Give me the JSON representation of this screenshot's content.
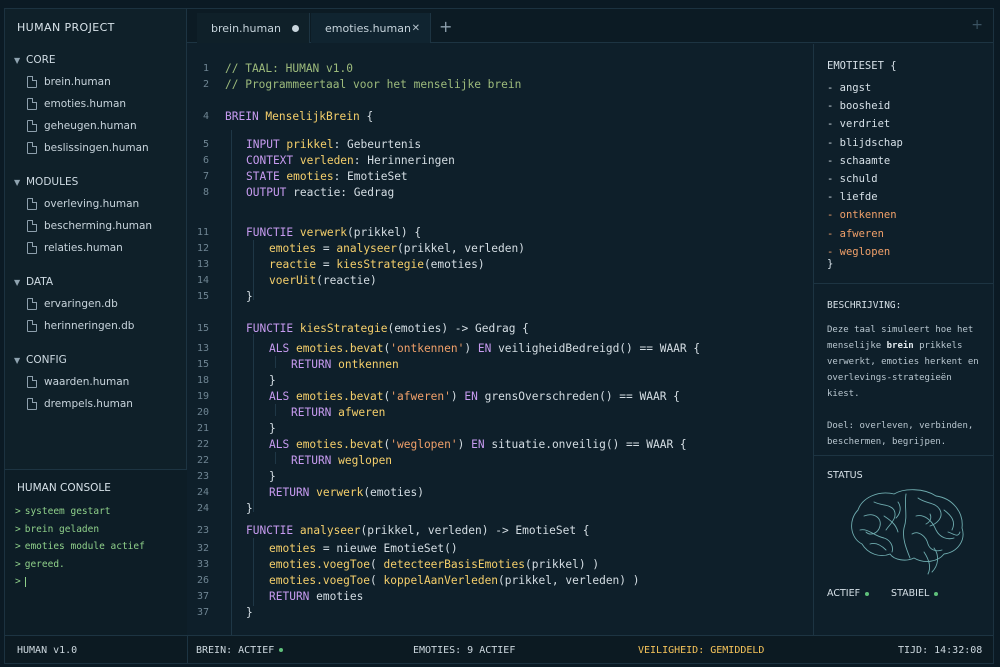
{
  "sidebar": {
    "title": "HUMAN PROJECT",
    "groups": [
      {
        "name": "CORE",
        "files": [
          "brein.human",
          "emoties.human",
          "geheugen.human",
          "beslissingen.human"
        ]
      },
      {
        "name": "MODULES",
        "files": [
          "overleving.human",
          "bescherming.human",
          "relaties.human"
        ]
      },
      {
        "name": "DATA",
        "files": [
          "ervaringen.db",
          "herinneringen.db"
        ]
      },
      {
        "name": "CONFIG",
        "files": [
          "waarden.human",
          "drempels.human"
        ]
      }
    ]
  },
  "console": {
    "title": "HUMAN CONSOLE",
    "lines": [
      "systeem gestart",
      "brein geladen",
      "emoties module actief",
      "gereed."
    ],
    "prompt": ">"
  },
  "tabs": {
    "items": [
      {
        "label": "brein.human",
        "modified": true
      },
      {
        "label": "emoties.human",
        "close": "✕"
      }
    ],
    "add": "+"
  },
  "editor": {
    "lines": [
      {
        "n": "1",
        "indent": 0,
        "tokens": [
          [
            "c",
            "// TAAL: HUMAN v1.0"
          ]
        ]
      },
      {
        "n": "2",
        "indent": 0,
        "tokens": [
          [
            "c",
            "// Programmeertaal voor het menselijke brein"
          ]
        ]
      },
      {
        "n": "4",
        "indent": 0,
        "tokens": [
          [
            "k",
            "BREIN "
          ],
          [
            "f",
            "MenselijkBrein"
          ],
          [
            "p",
            " {"
          ]
        ]
      },
      {
        "n": "5",
        "indent": 1,
        "tokens": [
          [
            "k",
            "INPUT "
          ],
          [
            "f",
            "prikkel"
          ],
          [
            "p",
            ": Gebeurtenis"
          ]
        ]
      },
      {
        "n": "6",
        "indent": 1,
        "tokens": [
          [
            "k",
            "CONTEXT "
          ],
          [
            "f",
            "verleden"
          ],
          [
            "p",
            ": Herinneringen"
          ]
        ]
      },
      {
        "n": "7",
        "indent": 1,
        "tokens": [
          [
            "k",
            "STATE "
          ],
          [
            "f",
            "emoties"
          ],
          [
            "p",
            ": EmotieSet"
          ]
        ]
      },
      {
        "n": "8",
        "indent": 1,
        "tokens": [
          [
            "k",
            "OUTPUT "
          ],
          [
            "p",
            "reactie: Gedrag"
          ]
        ]
      },
      {
        "n": "11",
        "indent": 1,
        "tokens": [
          [
            "k",
            "FUNCTIE "
          ],
          [
            "f",
            "verwerk"
          ],
          [
            "p",
            "(prikkel) {"
          ]
        ]
      },
      {
        "n": "12",
        "indent": 2,
        "tokens": [
          [
            "f",
            "emoties"
          ],
          [
            "p",
            " = "
          ],
          [
            "f",
            "analyseer"
          ],
          [
            "p",
            "(prikkel, verleden)"
          ]
        ]
      },
      {
        "n": "13",
        "indent": 2,
        "tokens": [
          [
            "f",
            "reactie"
          ],
          [
            "p",
            " = "
          ],
          [
            "f",
            "kiesStrategie"
          ],
          [
            "p",
            "(emoties)"
          ]
        ]
      },
      {
        "n": "14",
        "indent": 2,
        "tokens": [
          [
            "f",
            "voerUit"
          ],
          [
            "p",
            "(reactie)"
          ]
        ]
      },
      {
        "n": "15",
        "indent": 1,
        "tokens": [
          [
            "p",
            "}"
          ]
        ]
      },
      {
        "n": "15",
        "indent": 1,
        "tokens": [
          [
            "k",
            "FUNCTIE "
          ],
          [
            "f",
            "kiesStrategie"
          ],
          [
            "p",
            "(emoties) -> Gedrag {"
          ]
        ]
      },
      {
        "n": "13",
        "indent": 2,
        "tokens": [
          [
            "k",
            "ALS "
          ],
          [
            "f",
            "emoties.bevat"
          ],
          [
            "p",
            "("
          ],
          [
            "s",
            "'ontkennen'"
          ],
          [
            "p",
            ") "
          ],
          [
            "k",
            "EN "
          ],
          [
            "p",
            "veiligheidBedreigd() == WAAR {"
          ]
        ]
      },
      {
        "n": "15",
        "indent": 3,
        "tokens": [
          [
            "k",
            "RETURN "
          ],
          [
            "f",
            "ontkennen"
          ]
        ]
      },
      {
        "n": "18",
        "indent": 2,
        "tokens": [
          [
            "p",
            "}"
          ]
        ]
      },
      {
        "n": "19",
        "indent": 2,
        "tokens": [
          [
            "k",
            "ALS "
          ],
          [
            "f",
            "emoties.bevat"
          ],
          [
            "p",
            "("
          ],
          [
            "s",
            "'afweren'"
          ],
          [
            "p",
            ") "
          ],
          [
            "k",
            "EN "
          ],
          [
            "p",
            "grensOverschreden() == WAAR {"
          ]
        ]
      },
      {
        "n": "20",
        "indent": 3,
        "tokens": [
          [
            "k",
            "RETURN "
          ],
          [
            "f",
            "afweren"
          ]
        ]
      },
      {
        "n": "21",
        "indent": 2,
        "tokens": [
          [
            "p",
            "}"
          ]
        ]
      },
      {
        "n": "22",
        "indent": 2,
        "tokens": [
          [
            "k",
            "ALS "
          ],
          [
            "f",
            "emoties.bevat"
          ],
          [
            "p",
            "("
          ],
          [
            "s",
            "'weglopen'"
          ],
          [
            "p",
            ") "
          ],
          [
            "k",
            "EN "
          ],
          [
            "p",
            "situatie.onveilig() == WAAR {"
          ]
        ]
      },
      {
        "n": "22",
        "indent": 3,
        "tokens": [
          [
            "k",
            "RETURN "
          ],
          [
            "f",
            "weglopen"
          ]
        ]
      },
      {
        "n": "23",
        "indent": 2,
        "tokens": [
          [
            "p",
            "}"
          ]
        ]
      },
      {
        "n": "24",
        "indent": 2,
        "tokens": [
          [
            "k",
            "RETURN "
          ],
          [
            "f",
            "verwerk"
          ],
          [
            "p",
            "(emoties)"
          ]
        ]
      },
      {
        "n": "24",
        "indent": 1,
        "tokens": [
          [
            "p",
            "}"
          ]
        ]
      },
      {
        "n": "23",
        "indent": 1,
        "tokens": [
          [
            "k",
            "FUNCTIE "
          ],
          [
            "f",
            "analyseer"
          ],
          [
            "p",
            "(prikkel, verleden) -> EmotieSet {"
          ]
        ]
      },
      {
        "n": "32",
        "indent": 2,
        "tokens": [
          [
            "f",
            "emoties"
          ],
          [
            "p",
            " = nieuwe EmotieSet()"
          ]
        ]
      },
      {
        "n": "33",
        "indent": 2,
        "tokens": [
          [
            "f",
            "emoties.voegToe"
          ],
          [
            "p",
            "( "
          ],
          [
            "f",
            "detecteerBasisEmoties"
          ],
          [
            "p",
            "(prikkel) )"
          ]
        ]
      },
      {
        "n": "26",
        "indent": 2,
        "tokens": [
          [
            "f",
            "emoties.voegToe"
          ],
          [
            "p",
            "( "
          ],
          [
            "f",
            "koppelAanVerleden"
          ],
          [
            "p",
            "(prikkel, verleden) )"
          ]
        ]
      },
      {
        "n": "37",
        "indent": 2,
        "tokens": [
          [
            "k",
            "RETURN "
          ],
          [
            "p",
            "emoties"
          ]
        ]
      },
      {
        "n": "37",
        "indent": 1,
        "tokens": [
          [
            "p",
            "}"
          ]
        ]
      }
    ]
  },
  "emotieset": {
    "title": "EMOTIESET {",
    "items": [
      {
        "label": "- angst",
        "highlight": false
      },
      {
        "label": "- boosheid",
        "highlight": false
      },
      {
        "label": "- verdriet",
        "highlight": false
      },
      {
        "label": "- blijdschap",
        "highlight": false
      },
      {
        "label": "- schaamte",
        "highlight": false
      },
      {
        "label": "- schuld",
        "highlight": false
      },
      {
        "label": "- liefde",
        "highlight": false
      },
      {
        "label": "- ontkennen",
        "highlight": true
      },
      {
        "label": "- afweren",
        "highlight": true
      },
      {
        "label": "- weglopen",
        "highlight": true
      }
    ],
    "close": "}"
  },
  "description": {
    "title": "BESCHRIJVING:",
    "p1_a": "Deze taal simuleert hoe het menselijke ",
    "p1_b": "brein",
    "p1_c": " prikkels verwerkt, emoties herkent en overlevings-strategieën kiest.",
    "p2": "Doel: overleven, verbinden, beschermen, begrijpen."
  },
  "status": {
    "title": "STATUS",
    "flags": [
      "ACTIEF",
      "STABIEL"
    ]
  },
  "statusbar": {
    "version": "HUMAN v1.0",
    "brain": "BREIN: ACTIEF",
    "emotions": "EMOTIES: 9 ACTIEF",
    "safety": "VEILIGHEID: GEMIDDELD",
    "time": "TIJD: 14:32:08"
  },
  "colors": {
    "comment": "#9dbb7c",
    "keyword": "#c79bf0",
    "function": "#f5cf6b",
    "string": "#f0a06a",
    "ok": "#5fc07a",
    "warning": "#f5c35a"
  }
}
